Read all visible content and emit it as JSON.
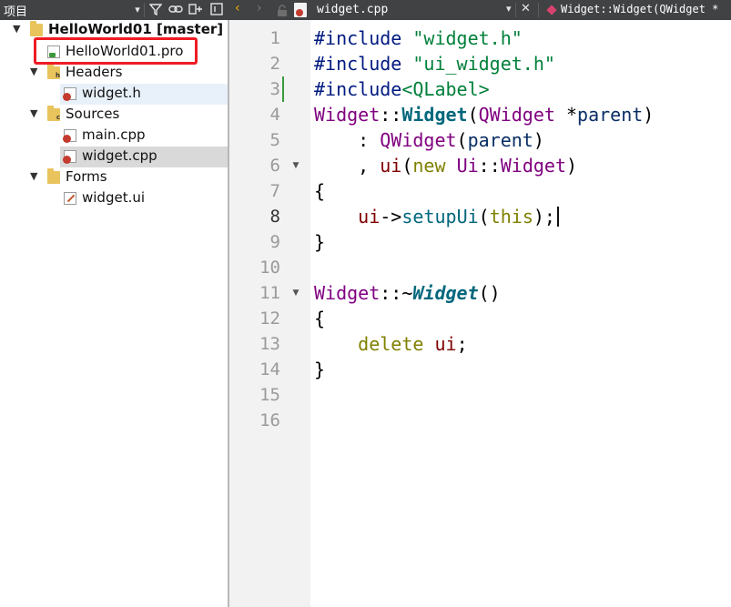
{
  "left_toolbar": {
    "title": "项目"
  },
  "editor_toolbar": {
    "file_name": "widget.cpp",
    "function_scope": "Widget::Widget(QWidget *"
  },
  "project_tree": {
    "project": "HelloWorld01 [master]",
    "pro_file": "HelloWorld01.pro",
    "headers_label": "Headers",
    "header_file": "widget.h",
    "sources_label": "Sources",
    "source_main": "main.cpp",
    "source_widget": "widget.cpp",
    "forms_label": "Forms",
    "form_file": "widget.ui"
  },
  "line_numbers": [
    "1",
    "2",
    "3",
    "4",
    "5",
    "6",
    "7",
    "8",
    "9",
    "10",
    "11",
    "12",
    "13",
    "14",
    "15",
    "16"
  ],
  "code": {
    "l1": {
      "kw": "#include",
      "str": " \"widget.h\""
    },
    "l2": {
      "kw": "#include",
      "str": " \"ui_widget.h\""
    },
    "l3": {
      "kw": "#include",
      "str": "<QLabel>"
    },
    "l4": {
      "cls": "Widget",
      "sep": "::",
      "fn": "Widget",
      "p1": "(",
      "type": "QWidget",
      "ptr": " *",
      "param": "parent",
      "p2": ")"
    },
    "l5": {
      "indent": "    : ",
      "type": "QWidget",
      "p1": "(",
      "param": "parent",
      "p2": ")"
    },
    "l6": {
      "indent": "    , ",
      "mem": "ui",
      "p1": "(",
      "kw": "new",
      "sp": " ",
      "type": "Ui",
      "sep": "::",
      "type2": "Widget",
      "p2": ")"
    },
    "l7": {
      "text": "{"
    },
    "l8": {
      "indent": "    ",
      "mem": "ui",
      "arrow": "->",
      "call": "setupUi",
      "p1": "(",
      "kw": "this",
      "p2": ");"
    },
    "l9": {
      "text": "}"
    },
    "l11": {
      "cls": "Widget",
      "sep": "::~",
      "fn": "Widget",
      "p": "()"
    },
    "l12": {
      "text": "{"
    },
    "l13": {
      "indent": "    ",
      "kw": "delete",
      "sp": " ",
      "mem": "ui",
      "end": ";"
    },
    "l14": {
      "text": "}"
    }
  },
  "current_line": "8",
  "colors": {
    "toolbar": "#404244",
    "highlight_box": "#ee1c24",
    "folder": "#e9c45c",
    "changed_line_marker": "#3c9a3c"
  },
  "icons": [
    "filter-icon",
    "link-icon",
    "split-icon",
    "close-pane-icon",
    "back-arrow-icon",
    "forward-arrow-icon",
    "lock-icon",
    "cpp-file-icon",
    "function-diamond-icon",
    "folder-icon",
    "pro-file-icon",
    "header-file-icon",
    "ui-file-icon"
  ]
}
